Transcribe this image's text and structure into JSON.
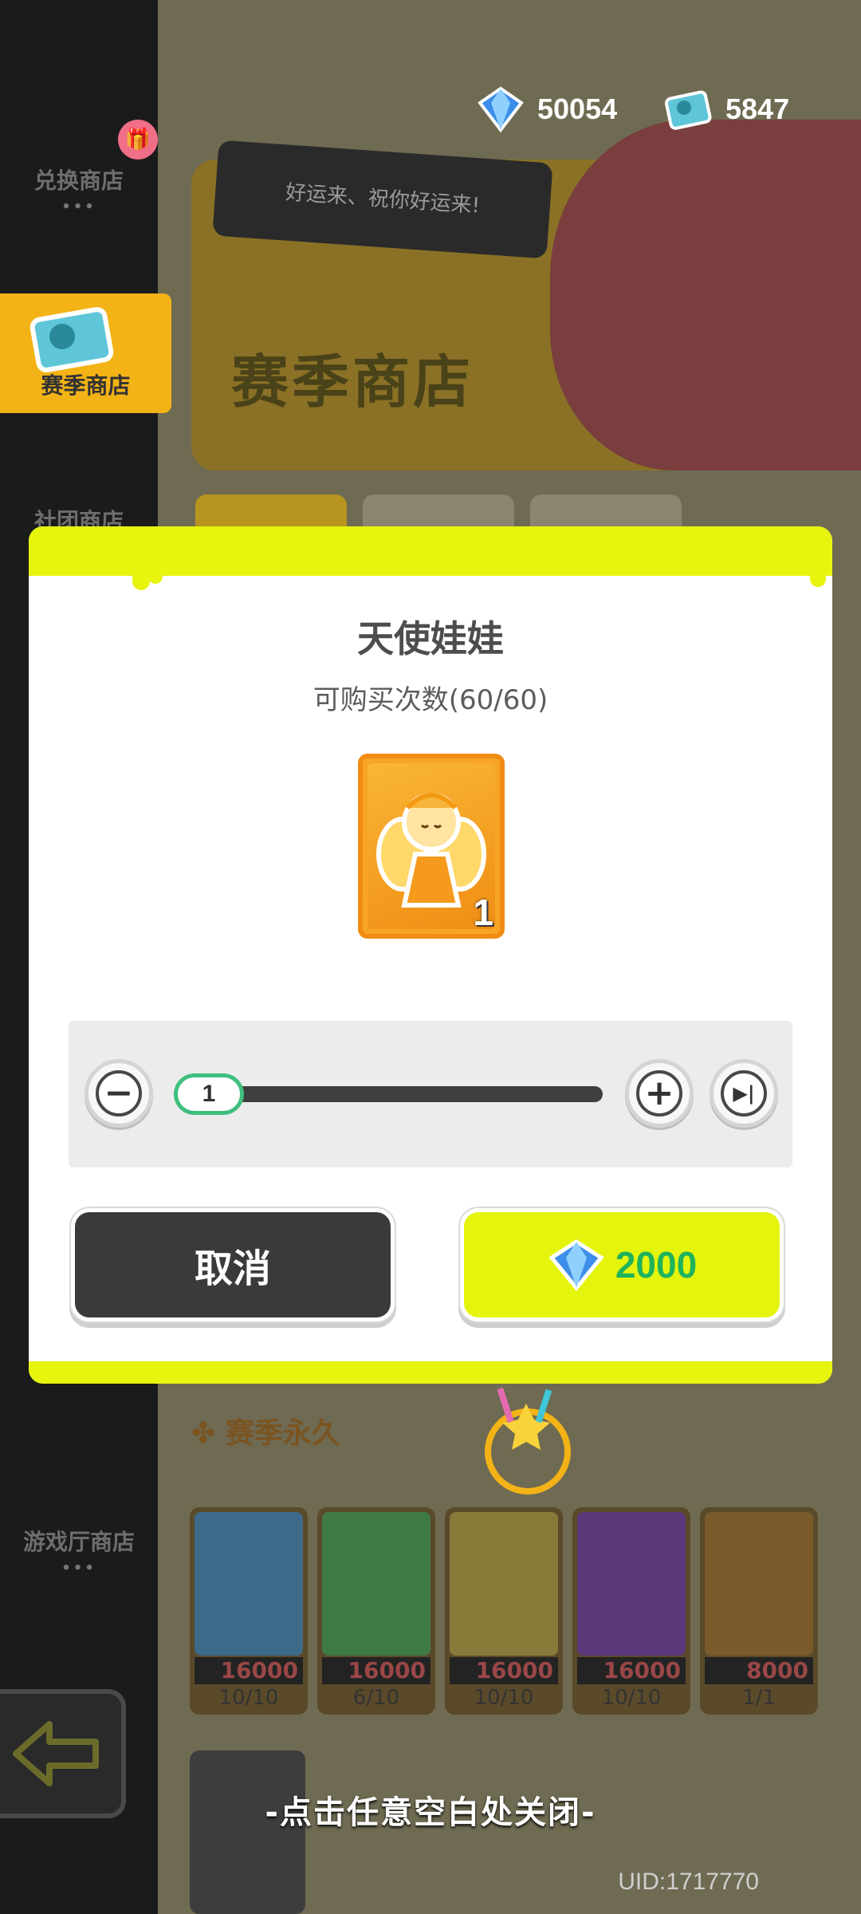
{
  "sidebar": {
    "items": [
      {
        "label": "兑换商店",
        "dots": "•••"
      },
      {
        "label": "赛季商店",
        "dots": ""
      },
      {
        "label": "社团商店",
        "dots": ""
      },
      {
        "label": "游戏厅商店",
        "dots": "•••"
      }
    ],
    "gift_badge": "🎁"
  },
  "currency": {
    "diamond": "50054",
    "season_ticket": "5847"
  },
  "banner": {
    "speech": "好运来、祝你好运来!",
    "title": "赛季商店"
  },
  "shop": {
    "section_title": "✤ 赛季永久",
    "cards": [
      {
        "price": "16000",
        "stock": "10/10",
        "color": "#3e6a8a"
      },
      {
        "price": "16000",
        "stock": "6/10",
        "color": "#3f7a45"
      },
      {
        "price": "16000",
        "stock": "10/10",
        "color": "#8a7a3a"
      },
      {
        "price": "16000",
        "stock": "10/10",
        "color": "#5a3a7a"
      },
      {
        "price": "8000",
        "stock": "1/1",
        "color": "#7a5a2a"
      }
    ]
  },
  "modal": {
    "item_name": "天使娃娃",
    "purchase_limit": "可购买次数(60/60)",
    "item_quantity": "1",
    "selected_amount": "1",
    "slider": {
      "min": 1,
      "max": 60,
      "value": 1
    },
    "minus_symbol": "−",
    "plus_symbol": "+",
    "max_symbol": "▶|",
    "cancel_label": "取消",
    "buy_price": "2000",
    "accent_color": "#e6f40e"
  },
  "close_hint": "-点击任意空白处关闭-",
  "uid": "UID:1717770"
}
